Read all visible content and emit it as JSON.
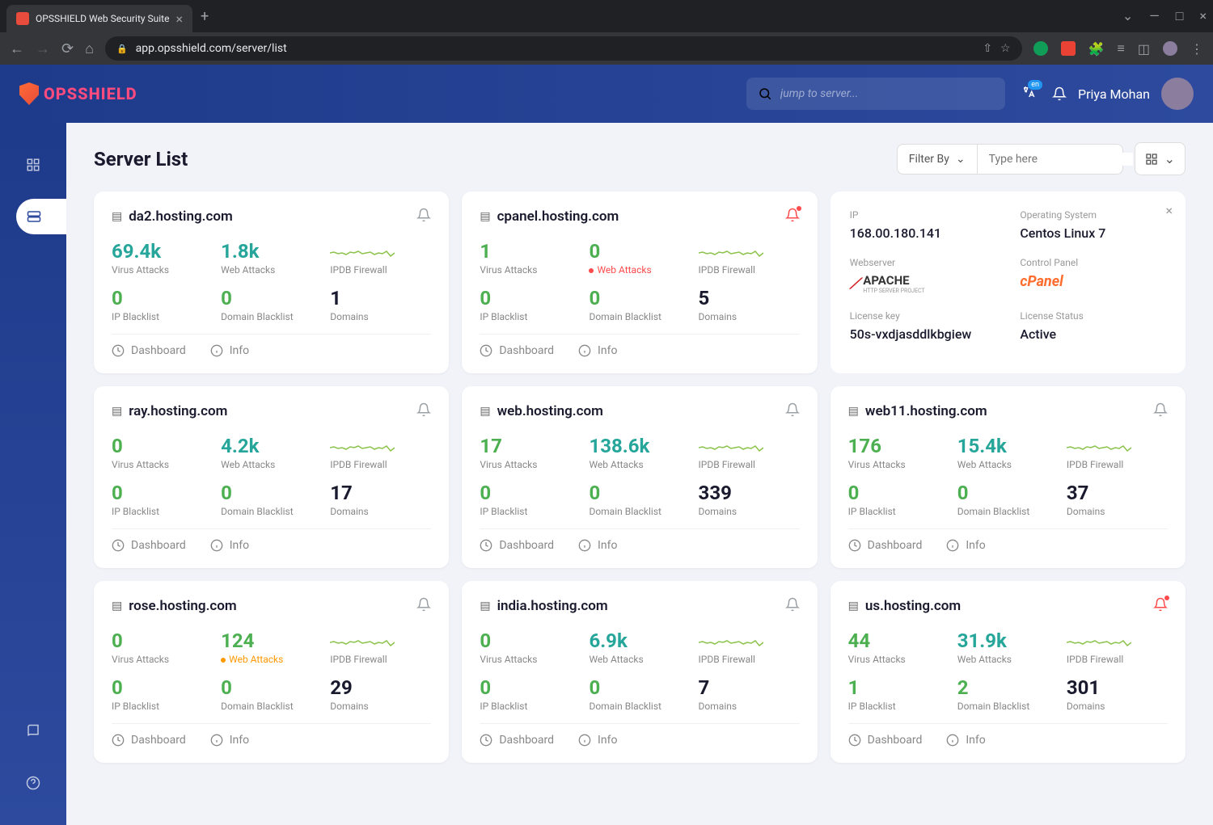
{
  "browser": {
    "tab_title": "OPSSHIELD Web Security Suite",
    "url": "app.opsshield.com/server/list"
  },
  "header": {
    "logo_text": "OPSSHIELD",
    "search_placeholder": "jump to server...",
    "lang_badge": "en",
    "user_name": "Priya Mohan"
  },
  "page": {
    "title": "Server List",
    "filter_label": "Filter By",
    "type_placeholder": "Type here"
  },
  "labels": {
    "virus_attacks": "Virus Attacks",
    "web_attacks": "Web Attacks",
    "ipdb_firewall": "IPDB Firewall",
    "ip_blacklist": "IP Blacklist",
    "domain_blacklist": "Domain Blacklist",
    "domains": "Domains",
    "dashboard": "Dashboard",
    "info": "Info"
  },
  "details": {
    "ip_label": "IP",
    "ip_value": "168.00.180.141",
    "os_label": "Operating System",
    "os_value": "Centos Linux 7",
    "webserver_label": "Webserver",
    "webserver_value": "APACHE",
    "webserver_sub": "HTTP SERVER PROJECT",
    "control_panel_label": "Control Panel",
    "control_panel_value": "cPanel",
    "license_key_label": "License key",
    "license_key_value": "50s-vxdjasddlkbgiew",
    "license_status_label": "License Status",
    "license_status_value": "Active"
  },
  "servers": [
    {
      "name": "da2.hosting.com",
      "virus": "69.4k",
      "virus_color": "mint",
      "web": "1.8k",
      "web_color": "mint",
      "web_alert": "",
      "ipbl": "0",
      "dombl": "0",
      "domains": "1",
      "bell_alert": false
    },
    {
      "name": "cpanel.hosting.com",
      "virus": "1",
      "virus_color": "green",
      "web": "0",
      "web_color": "green",
      "web_alert": "red",
      "ipbl": "0",
      "dombl": "0",
      "domains": "5",
      "bell_alert": true
    },
    {
      "name": "ray.hosting.com",
      "virus": "0",
      "virus_color": "green",
      "web": "4.2k",
      "web_color": "mint",
      "web_alert": "",
      "ipbl": "0",
      "dombl": "0",
      "domains": "17",
      "bell_alert": false
    },
    {
      "name": "web.hosting.com",
      "virus": "17",
      "virus_color": "green",
      "web": "138.6k",
      "web_color": "mint",
      "web_alert": "",
      "ipbl": "0",
      "dombl": "0",
      "domains": "339",
      "bell_alert": false
    },
    {
      "name": "web11.hosting.com",
      "virus": "176",
      "virus_color": "green",
      "web": "15.4k",
      "web_color": "mint",
      "web_alert": "",
      "ipbl": "0",
      "dombl": "0",
      "domains": "37",
      "bell_alert": false
    },
    {
      "name": "rose.hosting.com",
      "virus": "0",
      "virus_color": "green",
      "web": "124",
      "web_color": "green",
      "web_alert": "orange",
      "ipbl": "0",
      "dombl": "0",
      "domains": "29",
      "bell_alert": false
    },
    {
      "name": "india.hosting.com",
      "virus": "0",
      "virus_color": "green",
      "web": "6.9k",
      "web_color": "mint",
      "web_alert": "",
      "ipbl": "0",
      "dombl": "0",
      "domains": "7",
      "bell_alert": false
    },
    {
      "name": "us.hosting.com",
      "virus": "44",
      "virus_color": "green",
      "web": "31.9k",
      "web_color": "mint",
      "web_alert": "",
      "ipbl": "1",
      "dombl": "2",
      "domains": "301",
      "bell_alert": true
    }
  ]
}
